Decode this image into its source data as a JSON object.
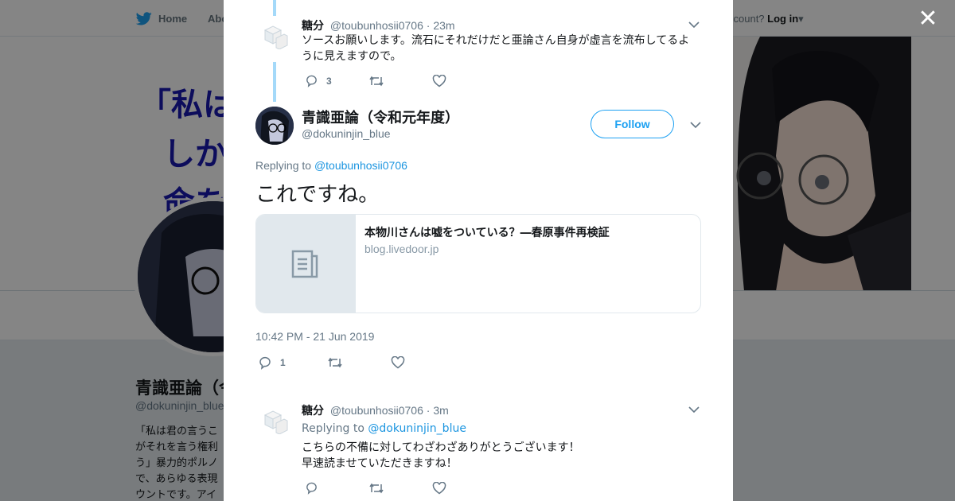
{
  "nav": {
    "home": "Home",
    "about": "Abo",
    "account_prompt": "ccount?",
    "login": "Log in"
  },
  "banner": {
    "lines": [
      "「私は",
      "しか",
      "命を"
    ]
  },
  "profile": {
    "name": "青識亜論（令",
    "handle": "@dokuninjin_blue",
    "bio_lines": [
      "「私は君の言うこ",
      "がそれを言う権利",
      "う」暴力的ポルノ",
      "で、あらゆる表現",
      "ウントです。アイ"
    ]
  },
  "thread": {
    "prev_reply": {
      "name": "糖分",
      "handle": "@toubunhosii0706",
      "time": "· 23m",
      "text": "ソースお願いします。流石にそれだけだと亜論さん自身が虚言を流布してるように見えますので。",
      "reply_count": "3"
    },
    "main": {
      "name": "青識亜論（令和元年度）",
      "handle": "@dokuninjin_blue",
      "follow_label": "Follow",
      "replying_prefix": "Replying to ",
      "replying_to": "@toubunhosii0706",
      "text": "これですね。",
      "card_title": "本物川さんは嘘をついている？―春原事件再検証",
      "card_domain": "blog.livedoor.jp",
      "timestamp": "10:42 PM - 21 Jun 2019",
      "reply_count": "1"
    },
    "next_reply": {
      "name": "糖分",
      "handle": "@toubunhosii0706",
      "time": "· 3m",
      "replying_prefix": "Replying to ",
      "replying_to": "@dokuninjin_blue",
      "line1": "こちらの不備に対してわざわざありがとうございます！",
      "line2": "早速読ませていただきますね！"
    }
  },
  "colors": {
    "twitter_blue": "#1da1f2",
    "link_blue": "#1b95e0",
    "thread_line": "#a4d9f9",
    "muted": "#657786"
  }
}
